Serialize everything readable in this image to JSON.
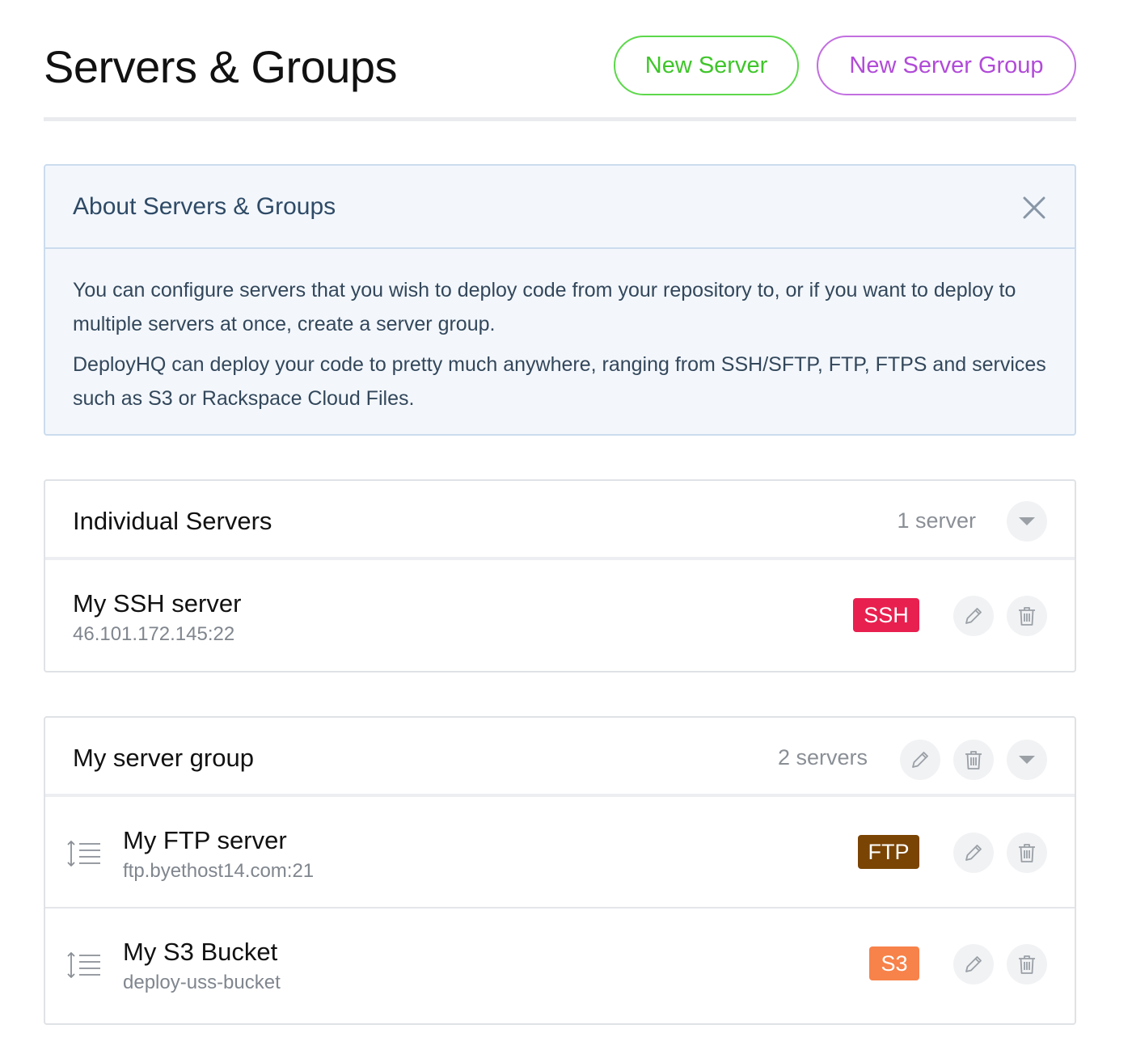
{
  "header": {
    "title": "Servers & Groups",
    "new_server_label": "New Server",
    "new_server_group_label": "New Server Group"
  },
  "info_box": {
    "title": "About Servers & Groups",
    "paragraphs": [
      "You can configure servers that you wish to deploy code from your repository to, or if you want to deploy to multiple servers at once, create a server group.",
      "DeployHQ can deploy your code to pretty much anywhere, ranging from SSH/SFTP, FTP, FTPS and services such as S3 or Rackspace Cloud Files."
    ]
  },
  "individual_servers": {
    "title": "Individual Servers",
    "count": "1 server",
    "servers": [
      {
        "name": "My SSH server",
        "host": "46.101.172.145:22",
        "protocol": "SSH",
        "badge_color": "#e8204f"
      }
    ]
  },
  "server_group": {
    "title": "My server group",
    "count": "2 servers",
    "servers": [
      {
        "name": "My FTP server",
        "host": "ftp.byethost14.com:21",
        "protocol": "FTP",
        "badge_color": "#7a4404"
      },
      {
        "name": "My S3 Bucket",
        "host": "deploy-uss-bucket",
        "protocol": "S3",
        "badge_color": "#f7824a"
      }
    ]
  },
  "icons": {
    "close": "close-icon",
    "edit": "pencil-icon",
    "delete": "trash-icon",
    "expand": "chevron-down-icon",
    "reorder": "drag-handle-icon"
  }
}
